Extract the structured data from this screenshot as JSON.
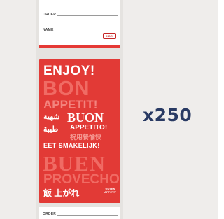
{
  "top_label": {
    "order_label": "ORDER",
    "name_label": "NAME",
    "logo_text": "NDR"
  },
  "card": {
    "enjoy": "ENJOY!",
    "bon": "BON",
    "appetit": "APPETIT!",
    "arabic_1": "شهية",
    "buon": "BUON",
    "appetito": "APPETITO!",
    "arabic_2": "طيبة",
    "chinese": "祝用餐愉快",
    "smakelijk": "EET SMAKELIJK!",
    "buen": "BUEN",
    "provecho": "PROVECHO!",
    "japanese": "飯 上がれ",
    "guten": "GUTEN",
    "appetit_small": "APPETIT"
  },
  "bottom_label": {
    "order_label": "ORDER"
  },
  "quantity_text": "x250",
  "colors": {
    "card_red": "#e23a36",
    "quantity_navy": "#293a63"
  }
}
